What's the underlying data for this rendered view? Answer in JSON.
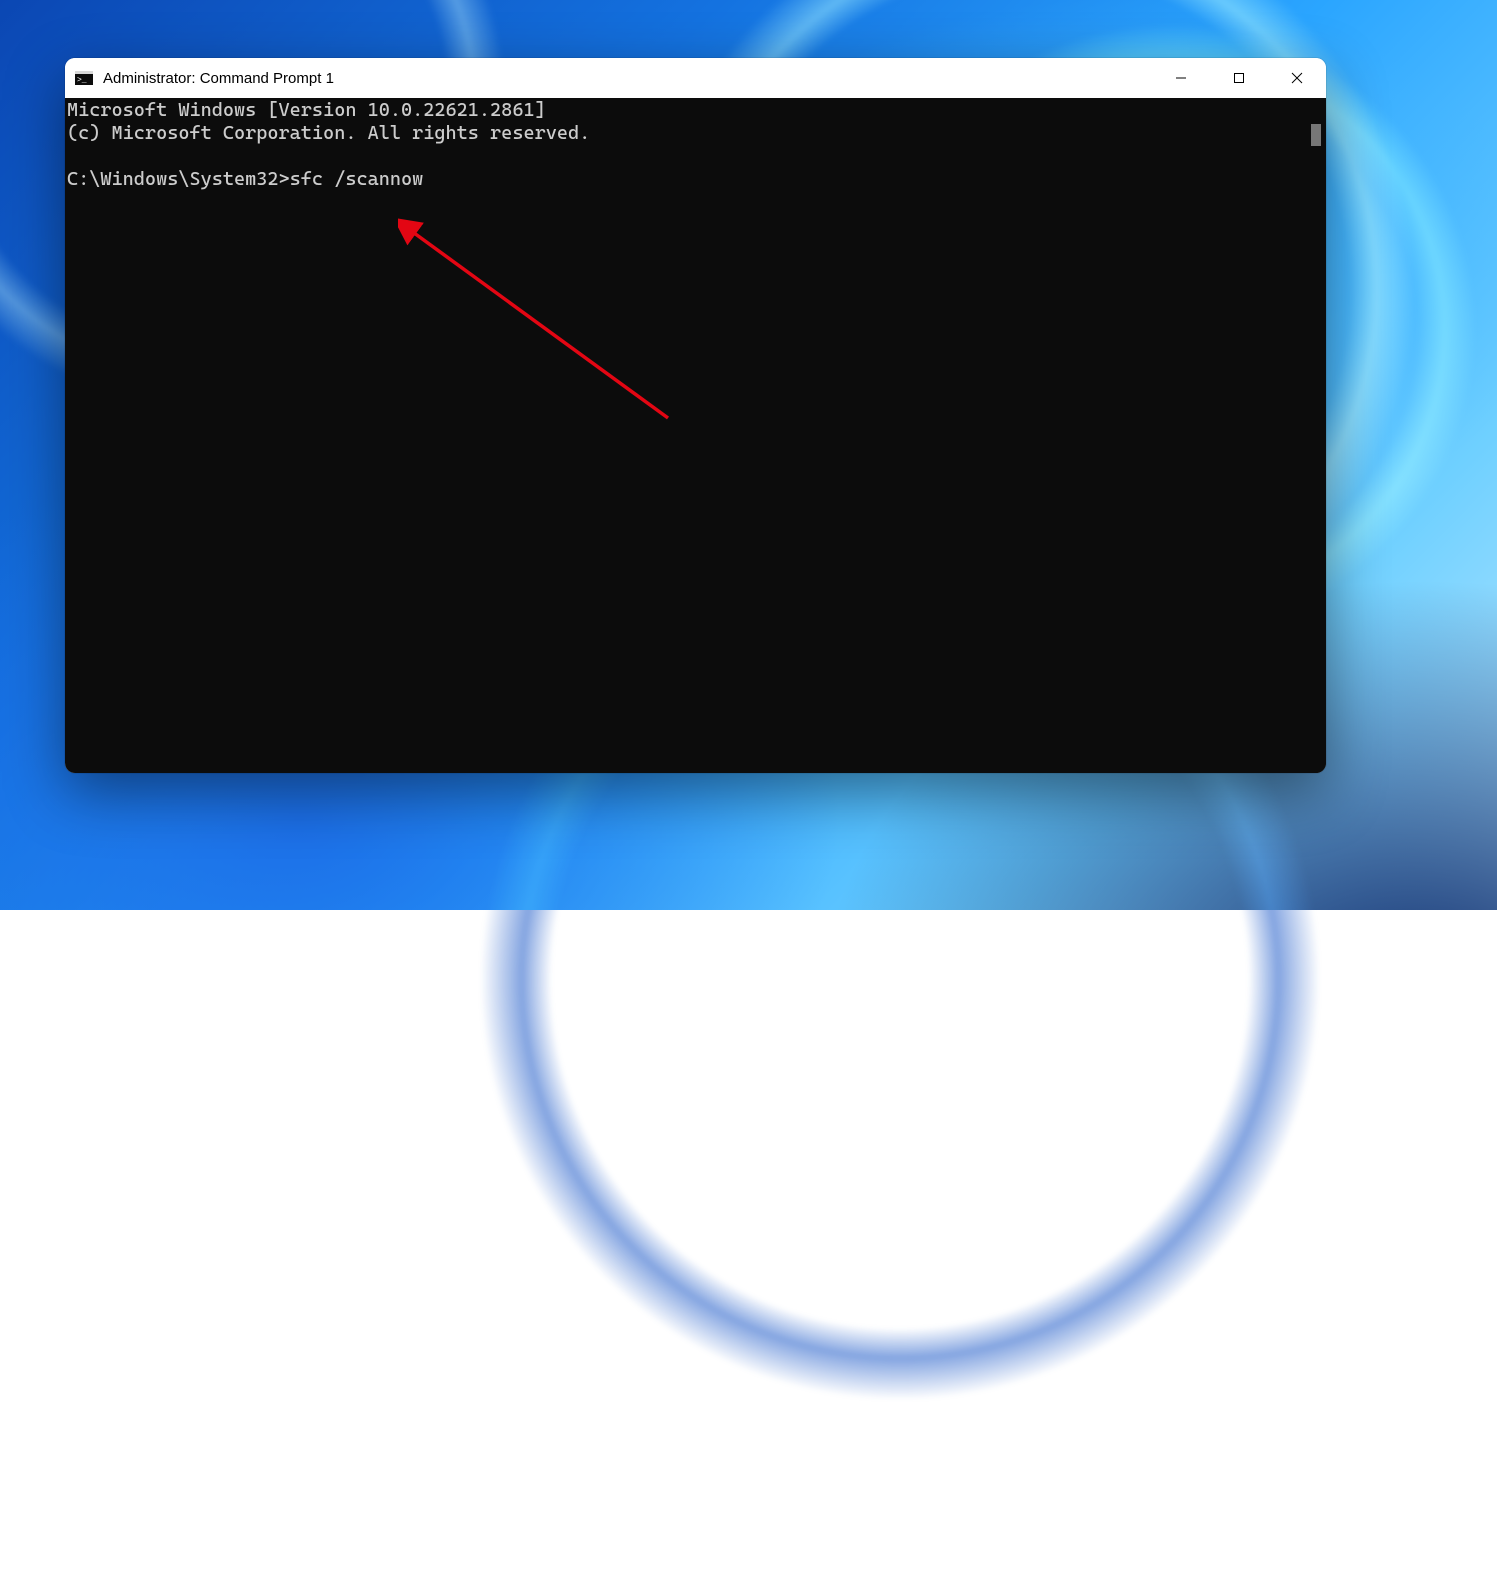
{
  "window": {
    "title": "Administrator: Command Prompt 1"
  },
  "terminal": {
    "line1": "Microsoft Windows [Version 10.0.22621.2861]",
    "line2": "(c) Microsoft Corporation. All rights reserved.",
    "blank": "",
    "prompt": "C:\\Windows\\System32>",
    "command": "sfc /scannow"
  }
}
